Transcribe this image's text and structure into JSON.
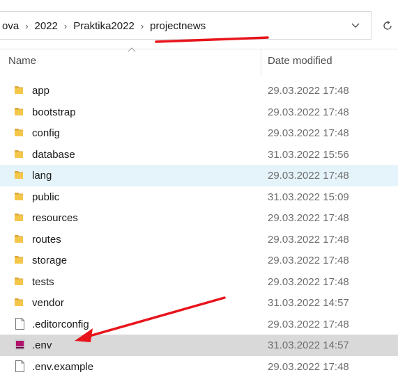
{
  "breadcrumbs": [
    "ova",
    "2022",
    "Praktika2022",
    "projectnews"
  ],
  "address": {
    "dropdown_icon": "chevron-down-icon",
    "refresh_icon": "refresh-icon"
  },
  "columns": {
    "name": "Name",
    "date_modified": "Date modified"
  },
  "files": [
    {
      "name": "app",
      "date": "29.03.2022 17:48",
      "type": "folder"
    },
    {
      "name": "bootstrap",
      "date": "29.03.2022 17:48",
      "type": "folder"
    },
    {
      "name": "config",
      "date": "29.03.2022 17:48",
      "type": "folder"
    },
    {
      "name": "database",
      "date": "31.03.2022 15:56",
      "type": "folder"
    },
    {
      "name": "lang",
      "date": "29.03.2022 17:48",
      "type": "folder",
      "state": "hover"
    },
    {
      "name": "public",
      "date": "31.03.2022 15:09",
      "type": "folder"
    },
    {
      "name": "resources",
      "date": "29.03.2022 17:48",
      "type": "folder"
    },
    {
      "name": "routes",
      "date": "29.03.2022 17:48",
      "type": "folder"
    },
    {
      "name": "storage",
      "date": "29.03.2022 17:48",
      "type": "folder"
    },
    {
      "name": "tests",
      "date": "29.03.2022 17:48",
      "type": "folder"
    },
    {
      "name": "vendor",
      "date": "31.03.2022 14:57",
      "type": "folder"
    },
    {
      "name": ".editorconfig",
      "date": "29.03.2022 17:48",
      "type": "file"
    },
    {
      "name": ".env",
      "date": "31.03.2022 14:57",
      "type": "env-file",
      "state": "selected"
    },
    {
      "name": ".env.example",
      "date": "29.03.2022 17:48",
      "type": "file"
    }
  ],
  "colors": {
    "folder": "#f4c64a",
    "hover_row": "#e5f3fb",
    "selected_row": "#d9d9d9",
    "annotation": "#e8141b"
  }
}
